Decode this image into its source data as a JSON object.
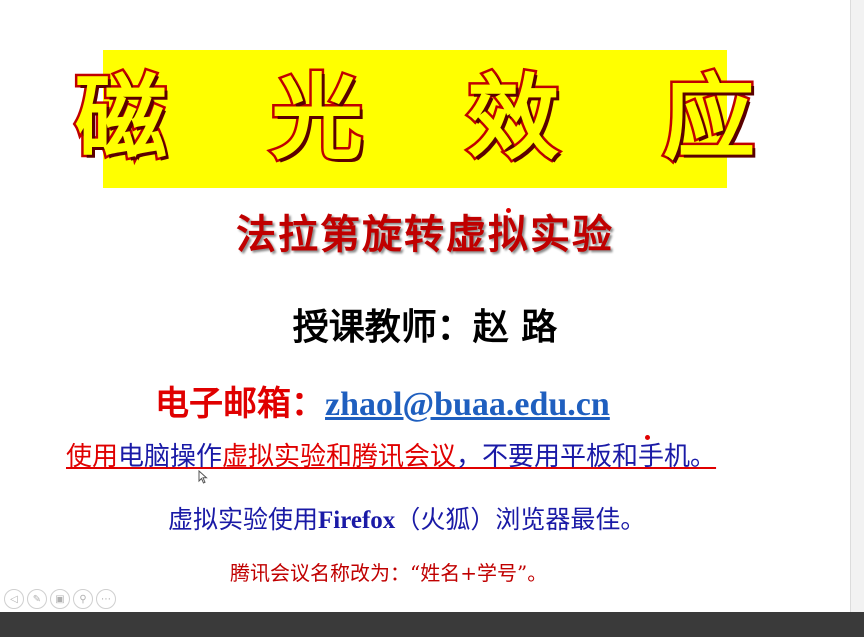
{
  "slide": {
    "title": "磁 光 效 应",
    "subtitle": "法拉第旋转虚拟实验",
    "teacher": "授课教师：赵 路",
    "email": {
      "label": "电子邮箱：",
      "address": "zhaol@buaa.edu.cn"
    },
    "notice": {
      "part_red_1": "使用",
      "part_blue_1": "电脑操作",
      "part_red_2": "虚拟实验和腾讯会议",
      "part_blue_2": "，不要用平板和手机。"
    },
    "browser_tip": {
      "before": "虚拟实验使用",
      "bold": "Firefox",
      "after": "（火狐）浏览器最佳。"
    },
    "rename_tip": "腾讯会议名称改为：“姓名+学号”。"
  },
  "controls": [
    {
      "icon": "previous-icon",
      "glyph": "◁"
    },
    {
      "icon": "pen-icon",
      "glyph": "✎"
    },
    {
      "icon": "slides-icon",
      "glyph": "▣"
    },
    {
      "icon": "zoom-icon",
      "glyph": "⚲"
    },
    {
      "icon": "more-icon",
      "glyph": "⋯"
    }
  ],
  "colors": {
    "title_bg": "#ffff00",
    "title_stroke": "#c00000",
    "subtitle": "#c00000",
    "email_label": "#e00000",
    "link": "#1f5fbf",
    "notice_red": "#e00000",
    "notice_blue": "#1a1aa6"
  }
}
